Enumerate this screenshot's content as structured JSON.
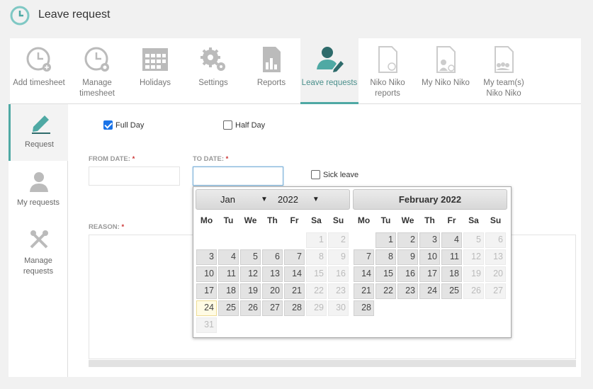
{
  "header": {
    "title": "Leave request"
  },
  "nav": [
    {
      "label": "Add timesheet",
      "icon": "clock-plus-icon"
    },
    {
      "label": "Manage timesheet",
      "icon": "clock-gear-icon"
    },
    {
      "label": "Holidays",
      "icon": "calendar-icon"
    },
    {
      "label": "Settings",
      "icon": "gears-icon"
    },
    {
      "label": "Reports",
      "icon": "report-chart-icon"
    },
    {
      "label": "Leave requests",
      "icon": "user-edit-icon"
    },
    {
      "label": "Niko Niko reports",
      "icon": "smiley-doc-icon"
    },
    {
      "label": "My Niko Niko",
      "icon": "user-doc-icon"
    },
    {
      "label": "My team(s) Niko Niko",
      "icon": "team-doc-icon"
    }
  ],
  "sidebar": [
    {
      "label": "Request",
      "icon": "pen-icon"
    },
    {
      "label": "My requests",
      "icon": "user-icon"
    },
    {
      "label": "Manage requests",
      "icon": "tools-icon"
    }
  ],
  "form": {
    "full_day": "Full Day",
    "half_day": "Half Day",
    "from_date": "FROM DATE:",
    "to_date": "TO DATE:",
    "required": "*",
    "sick_leave": "Sick leave",
    "reason": "REASON:",
    "from_value": "",
    "to_value": ""
  },
  "datepicker": {
    "weekdays": [
      "Mo",
      "Tu",
      "We",
      "Th",
      "Fr",
      "Sa",
      "Su"
    ],
    "month1": {
      "month_select": "Jan",
      "year_select": "2022"
    },
    "month2": {
      "title": "February 2022"
    },
    "jan_days": [
      "",
      "",
      "",
      "",
      "",
      "1",
      "2",
      "3",
      "4",
      "5",
      "6",
      "7",
      "8",
      "9",
      "10",
      "11",
      "12",
      "13",
      "14",
      "15",
      "16",
      "17",
      "18",
      "19",
      "20",
      "21",
      "22",
      "23",
      "24",
      "25",
      "26",
      "27",
      "28",
      "29",
      "30",
      "31"
    ],
    "feb_days": [
      "",
      "1",
      "2",
      "3",
      "4",
      "5",
      "6",
      "7",
      "8",
      "9",
      "10",
      "11",
      "12",
      "13",
      "14",
      "15",
      "16",
      "17",
      "18",
      "19",
      "20",
      "21",
      "22",
      "23",
      "24",
      "25",
      "26",
      "27",
      "28"
    ],
    "today": "24"
  },
  "colors": {
    "accent": "#4fa9a4",
    "checkbox": "#1a73e8"
  }
}
